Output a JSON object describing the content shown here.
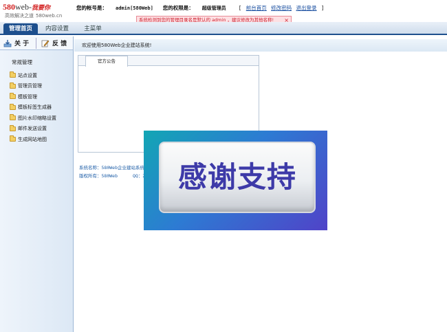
{
  "logo": {
    "number": "580",
    "word": "web-",
    "cn": "我要你",
    "slogan": "高效解决之道",
    "domain": "580web.cn"
  },
  "account": {
    "account_label": "您的帐号是：",
    "account_value": "admin[580Web]",
    "perm_label": "您的权限是：",
    "perm_value": "超级管理员",
    "bracket_open": "[",
    "bracket_close": "]",
    "links": [
      "前台首页",
      "修改密码",
      "退出登录"
    ]
  },
  "warning": {
    "text": "系统检测到您的管理目录名是默认的 admin ，建议修改为其他名称!",
    "close": "×"
  },
  "nav": {
    "tabs": [
      {
        "label": "管理首页",
        "active": true
      },
      {
        "label": "内容设置",
        "active": false
      },
      {
        "label": "主菜单",
        "active": false
      }
    ]
  },
  "sidebar": {
    "about": "关 于",
    "feedback": "反 馈",
    "section_title": "常规管理",
    "items": [
      "站点设置",
      "管理员管理",
      "模板管理",
      "模板标签生成器",
      "图片水印缩略设置",
      "邮件发送设置",
      "生成网站地图"
    ]
  },
  "main": {
    "welcome": "欢迎使用580Web企业建站系统!",
    "notice_tab": "官方公告",
    "sysinfo": {
      "name_line": "系统名称：580Web企业建站系统",
      "copyright_label": "版权所有：580Web",
      "qq_label": "QQ：253"
    }
  },
  "overlay": {
    "text": "感谢支持"
  },
  "colors": {
    "nav_active": "#1d4f8d",
    "link": "#1a4fa0",
    "warning_text": "#cc1f2e",
    "logo_red": "#d21f1f"
  }
}
